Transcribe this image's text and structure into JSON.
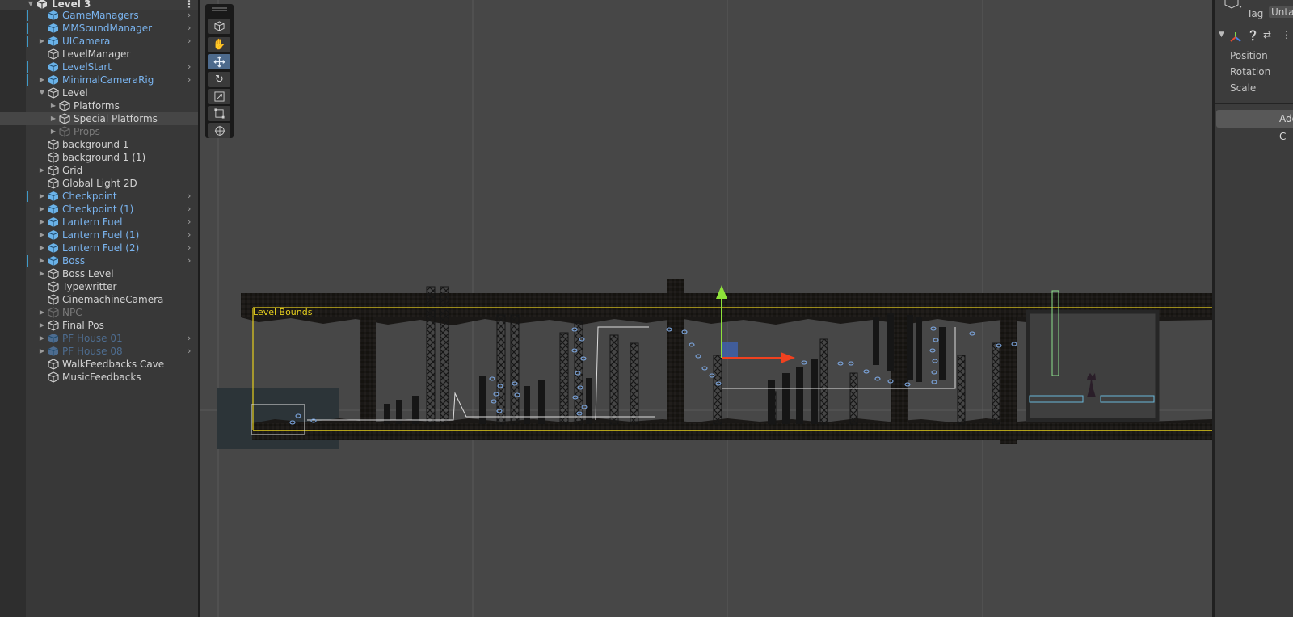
{
  "hierarchy": {
    "root": "Level 3",
    "items": [
      {
        "label": "GameManagers",
        "kind": "prefab",
        "depth": 1,
        "expand": false,
        "chevron": true,
        "bluebar": true
      },
      {
        "label": "MMSoundManager",
        "kind": "prefab",
        "depth": 1,
        "expand": false,
        "chevron": true,
        "bluebar": true
      },
      {
        "label": "UICamera",
        "kind": "prefab",
        "depth": 1,
        "expand": true,
        "chevron": true,
        "bluebar": true
      },
      {
        "label": "LevelManager",
        "kind": "normal",
        "depth": 1,
        "expand": false,
        "chevron": false,
        "bluebar": false
      },
      {
        "label": "LevelStart",
        "kind": "prefab",
        "depth": 1,
        "expand": false,
        "chevron": true,
        "bluebar": true
      },
      {
        "label": "MinimalCameraRig",
        "kind": "prefab",
        "depth": 1,
        "expand": true,
        "chevron": true,
        "bluebar": true
      },
      {
        "label": "Level",
        "kind": "normal",
        "depth": 1,
        "expand": "open",
        "chevron": false,
        "bluebar": false
      },
      {
        "label": "Platforms",
        "kind": "normal",
        "depth": 2,
        "expand": true,
        "chevron": false,
        "bluebar": false
      },
      {
        "label": "Special Platforms",
        "kind": "selected",
        "depth": 2,
        "expand": true,
        "chevron": false,
        "bluebar": false
      },
      {
        "label": "Props",
        "kind": "disabled",
        "depth": 2,
        "expand": true,
        "chevron": false,
        "bluebar": false
      },
      {
        "label": "background 1",
        "kind": "normal",
        "depth": 1,
        "expand": false,
        "chevron": false,
        "bluebar": false
      },
      {
        "label": "background 1 (1)",
        "kind": "normal",
        "depth": 1,
        "expand": false,
        "chevron": false,
        "bluebar": false
      },
      {
        "label": "Grid",
        "kind": "normal",
        "depth": 1,
        "expand": true,
        "chevron": false,
        "bluebar": false
      },
      {
        "label": "Global Light 2D",
        "kind": "normal",
        "depth": 1,
        "expand": false,
        "chevron": false,
        "bluebar": false
      },
      {
        "label": "Checkpoint",
        "kind": "prefab",
        "depth": 1,
        "expand": true,
        "chevron": true,
        "bluebar": true
      },
      {
        "label": "Checkpoint (1)",
        "kind": "prefab",
        "depth": 1,
        "expand": true,
        "chevron": true,
        "bluebar": false
      },
      {
        "label": "Lantern Fuel",
        "kind": "prefab",
        "depth": 1,
        "expand": true,
        "chevron": true,
        "bluebar": false
      },
      {
        "label": "Lantern Fuel (1)",
        "kind": "prefab",
        "depth": 1,
        "expand": true,
        "chevron": true,
        "bluebar": false
      },
      {
        "label": "Lantern Fuel (2)",
        "kind": "prefab",
        "depth": 1,
        "expand": true,
        "chevron": true,
        "bluebar": false
      },
      {
        "label": "Boss",
        "kind": "prefab",
        "depth": 1,
        "expand": true,
        "chevron": true,
        "bluebar": true
      },
      {
        "label": "Boss Level",
        "kind": "normal",
        "depth": 1,
        "expand": true,
        "chevron": false,
        "bluebar": false
      },
      {
        "label": "Typewritter",
        "kind": "normal",
        "depth": 1,
        "expand": false,
        "chevron": false,
        "bluebar": false
      },
      {
        "label": "CinemachineCamera",
        "kind": "normal",
        "depth": 1,
        "expand": false,
        "chevron": false,
        "bluebar": false
      },
      {
        "label": "NPC",
        "kind": "disabled",
        "depth": 1,
        "expand": true,
        "chevron": false,
        "bluebar": false
      },
      {
        "label": "Final Pos",
        "kind": "normal",
        "depth": 1,
        "expand": true,
        "chevron": false,
        "bluebar": false
      },
      {
        "label": "PF House 01",
        "kind": "disabled-prefab",
        "depth": 1,
        "expand": true,
        "chevron": true,
        "bluebar": false
      },
      {
        "label": "PF House 08",
        "kind": "disabled-prefab",
        "depth": 1,
        "expand": true,
        "chevron": true,
        "bluebar": false
      },
      {
        "label": "WalkFeedbacks Cave",
        "kind": "normal",
        "depth": 1,
        "expand": false,
        "chevron": false,
        "bluebar": false
      },
      {
        "label": "MusicFeedbacks",
        "kind": "normal",
        "depth": 1,
        "expand": false,
        "chevron": false,
        "bluebar": false
      }
    ]
  },
  "scene": {
    "bounds_label": "Level Bounds",
    "tools": [
      "view-cube",
      "hand",
      "move",
      "rotate",
      "scale",
      "rect",
      "transform"
    ]
  },
  "inspector": {
    "tag_label": "Tag",
    "tag_value": "Unta",
    "fields": [
      "Position",
      "Rotation",
      "Scale"
    ],
    "add_component": "Add C"
  },
  "colors": {
    "prefab_text": "#7ab4ef",
    "bounds": "#e6cf1d",
    "gizmo_y": "#8ee23a",
    "gizmo_x": "#f0411f"
  }
}
